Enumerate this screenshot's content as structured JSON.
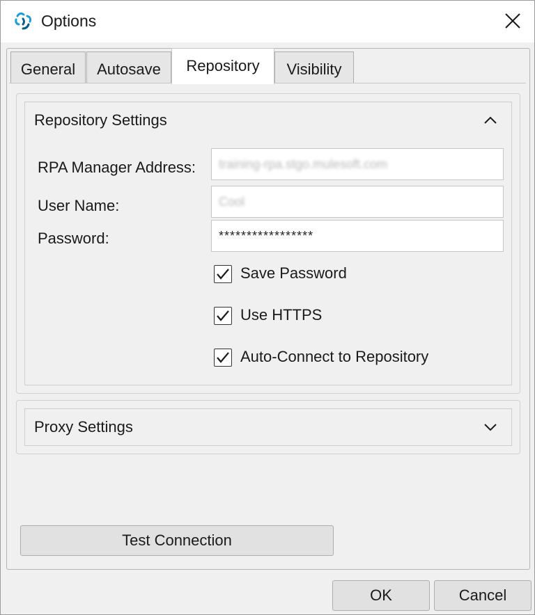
{
  "window": {
    "title": "Options"
  },
  "tabs": [
    {
      "label": "General"
    },
    {
      "label": "Autosave"
    },
    {
      "label": "Repository",
      "active": true
    },
    {
      "label": "Visibility"
    }
  ],
  "repository": {
    "section_title": "Repository Settings",
    "address_label": "RPA Manager Address:",
    "address_value": "training-rpa.stgo.mulesoft.com",
    "username_label": "User Name:",
    "username_value": "Cool",
    "password_label": "Password:",
    "password_value": "*****************",
    "save_password_label": "Save Password",
    "use_https_label": "Use HTTPS",
    "auto_connect_label": "Auto-Connect to Repository",
    "save_password_checked": true,
    "use_https_checked": true,
    "auto_connect_checked": true
  },
  "proxy": {
    "section_title": "Proxy Settings"
  },
  "buttons": {
    "test_connection": "Test Connection",
    "ok": "OK",
    "cancel": "Cancel"
  },
  "colors": {
    "icon_primary": "#1a9ed8",
    "icon_secondary": "#0b5d8a"
  }
}
